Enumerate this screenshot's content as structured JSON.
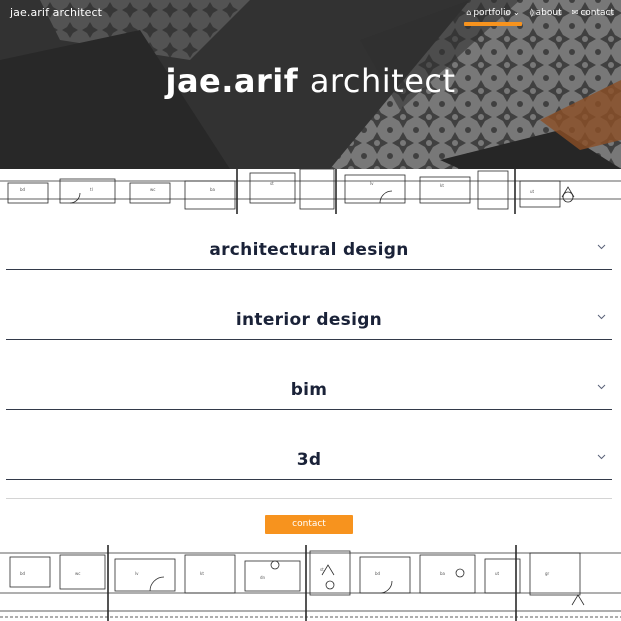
{
  "header": {
    "site_title": "jae.arif architect",
    "nav": [
      {
        "icon": "⌂",
        "label": "portfolio",
        "caret": "⌄",
        "active": true
      },
      {
        "icon": "◊",
        "label": "about"
      },
      {
        "icon": "✉",
        "label": "contact"
      }
    ]
  },
  "hero": {
    "title_bold": "jae.arif",
    "title_light": "architect"
  },
  "accordion": [
    {
      "label": "architectural design",
      "icon": "chevron-down-icon"
    },
    {
      "label": "interior design",
      "icon": "chevron-down-icon"
    },
    {
      "label": "bim",
      "icon": "chevron-down-icon"
    },
    {
      "label": "3d",
      "icon": "chevron-down-icon"
    }
  ],
  "cta": {
    "label": "contact"
  },
  "colors": {
    "accent": "#f7931e",
    "text_dark": "#1a2238",
    "hero_bg": "#4a4a4a"
  }
}
